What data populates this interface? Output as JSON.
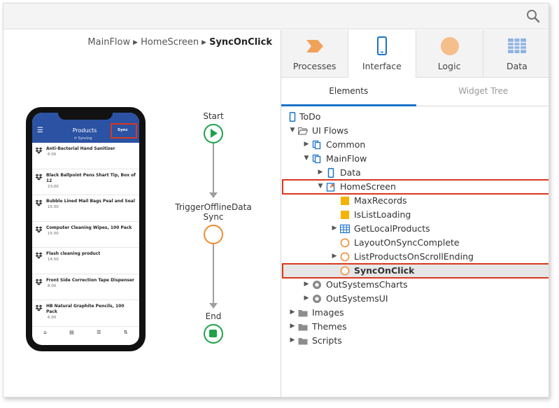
{
  "breadcrumb": {
    "part1": "MainFlow",
    "part2": "HomeScreen",
    "current": "SyncOnClick"
  },
  "phone": {
    "header_title": "Products",
    "sync_button": "Sync",
    "syncing_text": "Syncing",
    "menu_icon": "hamburger-icon",
    "products": [
      {
        "name": "Anti-Bacterial Hand Sanitizer",
        "price": "6.00"
      },
      {
        "name": "Black Ballpoint Pens Shart Tip, Box of 12",
        "price": "23.00"
      },
      {
        "name": "Bubble Lined Mail Bags Peal and Seal",
        "price": "15.00"
      },
      {
        "name": "Computer Cleaning Wipes, 100 Pack",
        "price": "15.00"
      },
      {
        "name": "Flash cleaning product",
        "price": "14.50"
      },
      {
        "name": "Front Side Correction Tape Dispenser",
        "price": "8.00"
      },
      {
        "name": "HB Natural Graphite Pencils, 100 Pack",
        "price": "6.00"
      }
    ],
    "nav_icons": [
      "home-icon",
      "database-icon",
      "list-icon",
      "sort-icon"
    ]
  },
  "flow": {
    "start": "Start",
    "action_line1": "TriggerOfflineData",
    "action_line2": "Sync",
    "end": "End"
  },
  "panel": {
    "tabs": [
      {
        "label": "Processes",
        "icon": "processes-chevron-icon"
      },
      {
        "label": "Interface",
        "icon": "mobile-device-icon"
      },
      {
        "label": "Logic",
        "icon": "logic-circle-icon"
      },
      {
        "label": "Data",
        "icon": "data-grid-icon"
      }
    ],
    "active_tab": "Interface",
    "subtabs": [
      "Elements",
      "Widget Tree"
    ],
    "active_subtab": "Elements",
    "tree": [
      {
        "label": "ToDo"
      },
      {
        "label": "UI Flows"
      },
      {
        "label": "Common"
      },
      {
        "label": "MainFlow"
      },
      {
        "label": "Data"
      },
      {
        "label": "HomeScreen"
      },
      {
        "label": "MaxRecords"
      },
      {
        "label": "IsListLoading"
      },
      {
        "label": "GetLocalProducts"
      },
      {
        "label": "LayoutOnSyncComplete"
      },
      {
        "label": "ListProductsOnScrollEnding"
      },
      {
        "label": "SyncOnClick"
      },
      {
        "label": "OutSystemsCharts"
      },
      {
        "label": "OutSystemsUI"
      },
      {
        "label": "Images"
      },
      {
        "label": "Themes"
      },
      {
        "label": "Scripts"
      }
    ]
  },
  "colors": {
    "accent_blue": "#1a73c9",
    "highlight_red": "#d9381e",
    "flow_green": "#1fa24a",
    "action_orange": "#ef8a32",
    "app_header_blue": "#2b52a3",
    "variable_yellow": "#f5b301"
  }
}
